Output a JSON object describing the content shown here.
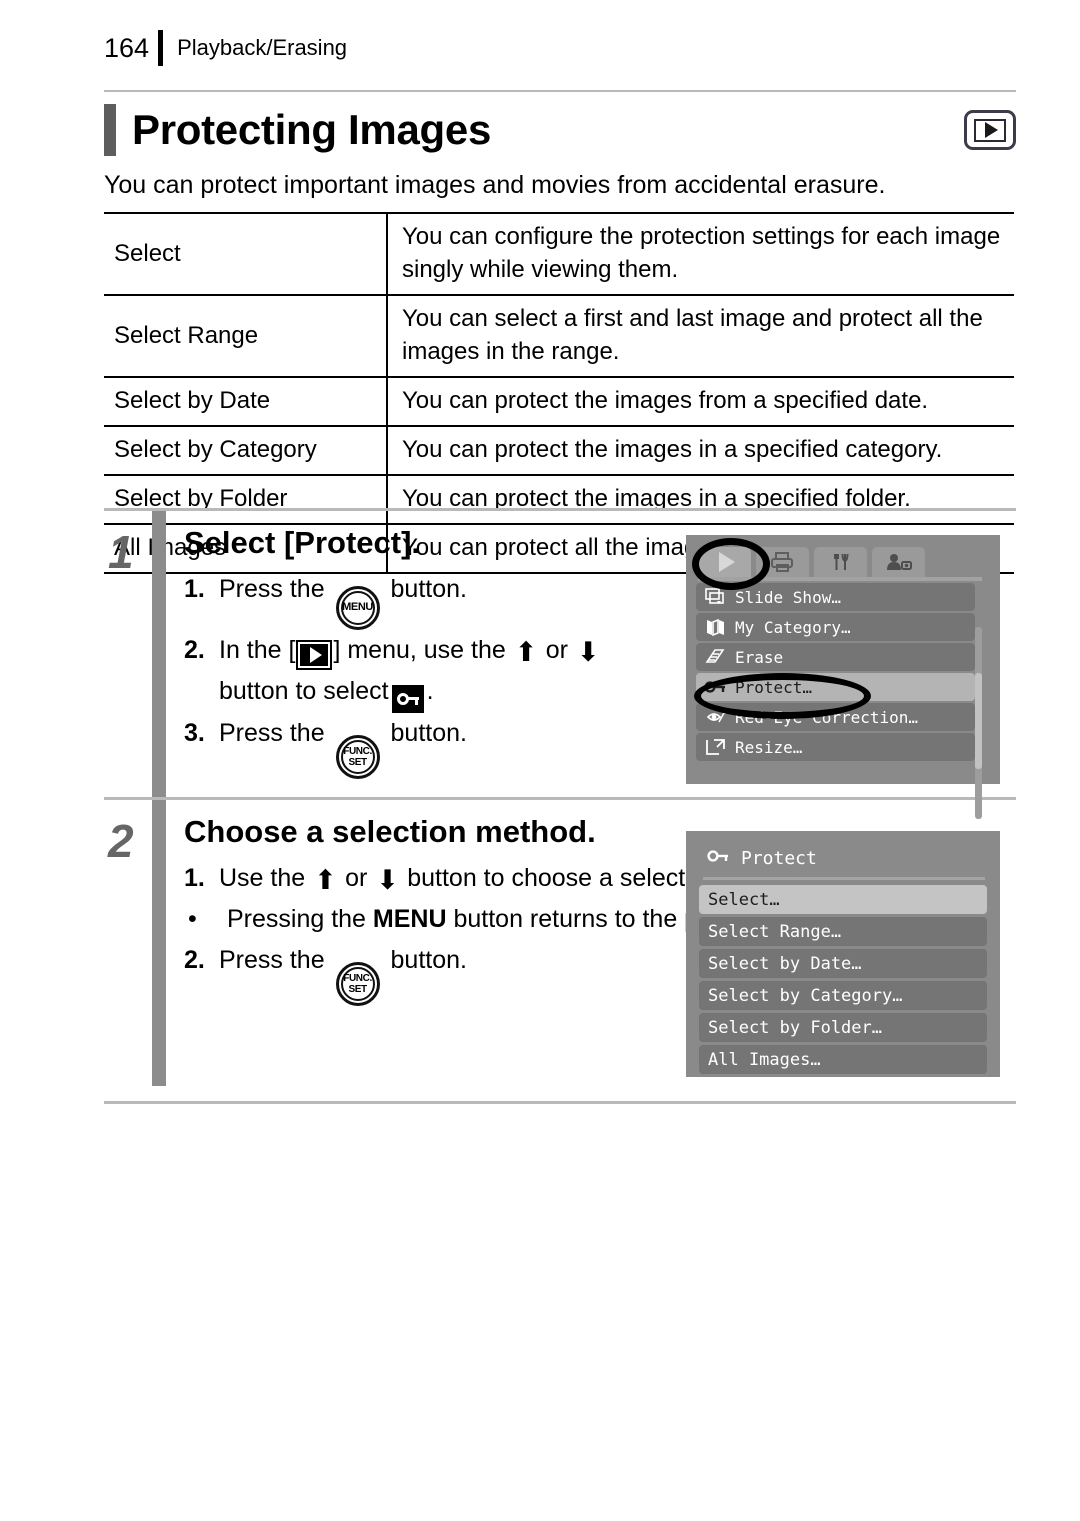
{
  "header": {
    "page_number": "164",
    "section": "Playback/Erasing"
  },
  "title": {
    "heading": "Protecting Images",
    "badge_icon": "playback-mode-icon"
  },
  "lead_paragraph": "You can protect important images and movies from accidental erasure.",
  "feature_table": {
    "rows": [
      {
        "name": "Select",
        "description": "You can configure the protection settings for each image singly while viewing them."
      },
      {
        "name": "Select Range",
        "description": "You can select a first and last image and protect all the images in the range."
      },
      {
        "name": "Select by Date",
        "description": "You can protect the images from a specified date."
      },
      {
        "name": "Select by Category",
        "description": "You can protect the images in a specified category."
      },
      {
        "name": "Select by Folder",
        "description": "You can protect the images in a specified folder."
      },
      {
        "name": "All Images",
        "description": "You can protect all the images on a memory card."
      }
    ]
  },
  "steps": [
    {
      "number": "1",
      "title": "Select [Protect].",
      "lines": [
        {
          "marker": "1.",
          "before": "Press the",
          "icon": "menu-button-icon",
          "after": "button."
        },
        {
          "marker": "2.",
          "before": "In the [",
          "icon": "playback-icon",
          "middle": "] menu, use the",
          "arrow_up": "⬆",
          "or": "or",
          "arrow_down": "⬇",
          "after": "button to select",
          "icon2": "key-protect-icon",
          "tail": "."
        },
        {
          "marker": "3.",
          "before": "Press the",
          "icon": "func-set-button-icon",
          "after": "button."
        }
      ],
      "line2_wrap": "button to select"
    },
    {
      "number": "2",
      "title": "Choose a selection method.",
      "lines": [
        {
          "marker": "1.",
          "before": "Use the",
          "arrow_up": "⬆",
          "or": "or",
          "arrow_down": "⬇",
          "after": "button to choose a selection method."
        },
        {
          "marker": "•",
          "before": "Pressing the",
          "bold": "MENU",
          "after": "button returns to the prior screen."
        },
        {
          "marker": "2.",
          "before": "Press the",
          "icon": "func-set-button-icon",
          "after": "button."
        }
      ]
    }
  ],
  "button_icons": {
    "menu_label": "MENU",
    "func_label_top": "FUNC.",
    "func_label_bottom": "SET"
  },
  "lcd_playback_menu": {
    "tabs": [
      {
        "name": "playback-tab",
        "icon": "play-triangle-icon",
        "active": true
      },
      {
        "name": "print-tab",
        "icon": "printer-icon",
        "active": false
      },
      {
        "name": "settings-tab",
        "icon": "tools-icon",
        "active": false
      },
      {
        "name": "my-camera-tab",
        "icon": "person-camera-icon",
        "active": false
      }
    ],
    "items": [
      {
        "label": "Slide Show…",
        "icon": "slideshow-icon",
        "selected": false
      },
      {
        "label": "My Category…",
        "icon": "my-category-icon",
        "selected": false
      },
      {
        "label": "Erase",
        "icon": "erase-icon",
        "selected": false
      },
      {
        "label": "Protect…",
        "icon": "key-protect-icon",
        "selected": true
      },
      {
        "label": "Red-Eye Correction…",
        "icon": "red-eye-icon",
        "selected": false
      },
      {
        "label": "Resize…",
        "icon": "resize-icon",
        "selected": false
      }
    ]
  },
  "lcd_protect_menu": {
    "title": "Protect",
    "title_icon": "key-protect-icon",
    "options": [
      {
        "label": "Select…",
        "selected": true
      },
      {
        "label": "Select Range…",
        "selected": false
      },
      {
        "label": "Select by Date…",
        "selected": false
      },
      {
        "label": "Select by Category…",
        "selected": false
      },
      {
        "label": "Select by Folder…",
        "selected": false
      },
      {
        "label": "All Images…",
        "selected": false
      }
    ]
  },
  "colors": {
    "lcd_background": "#8a8a8a",
    "lcd_item": "#757575",
    "lcd_item_selected": "#b4b4b4",
    "step_divider": "#8c8c8c",
    "step_number": "#666666",
    "title_bar": "#5d5d5d",
    "rule": "#b9b9b9"
  }
}
